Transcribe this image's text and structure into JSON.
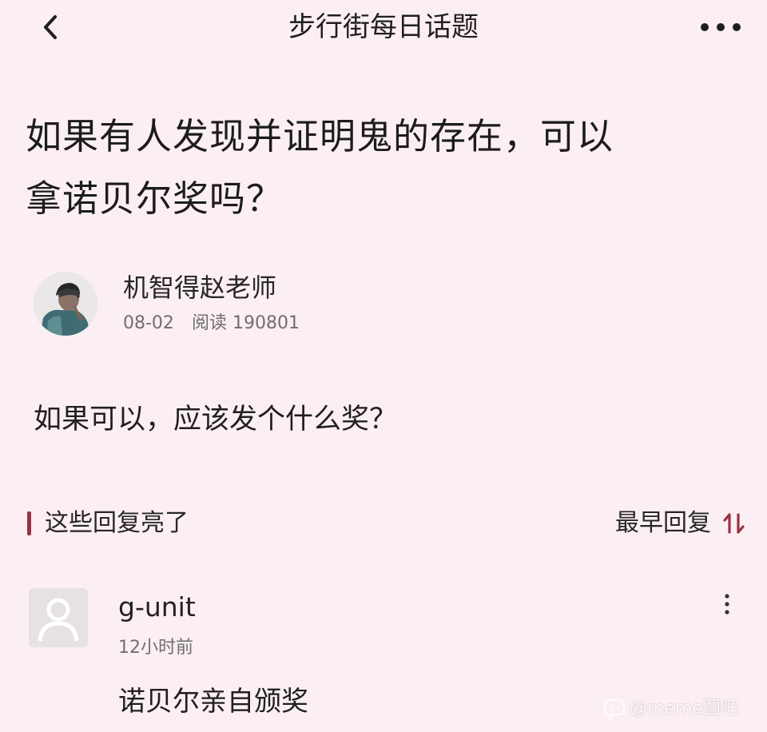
{
  "header": {
    "title": "步行街每日话题",
    "back_icon": "chevron-left-icon",
    "more_icon": "more-horizontal-icon"
  },
  "post": {
    "title_line1": "如果有人发现并证明鬼的存在，可以",
    "title_line2": "拿诺贝尔奖吗？",
    "author": "机智得赵老师",
    "date": "08-02",
    "reads_label": "阅读",
    "reads_count": "190801",
    "body": "如果可以，应该发个什么奖？"
  },
  "replies": {
    "section_title": "这些回复亮了",
    "sort_label": "最早回复",
    "sort_icon": "sort-arrows-icon",
    "items": [
      {
        "user": "g-unit",
        "time": "12小时前",
        "text": "诺贝尔亲自颁奖",
        "more_icon": "more-vertical-icon"
      }
    ]
  },
  "watermark": {
    "text": "@meme图吧"
  },
  "colors": {
    "background": "#fbeff3",
    "accent": "#9b3145"
  }
}
